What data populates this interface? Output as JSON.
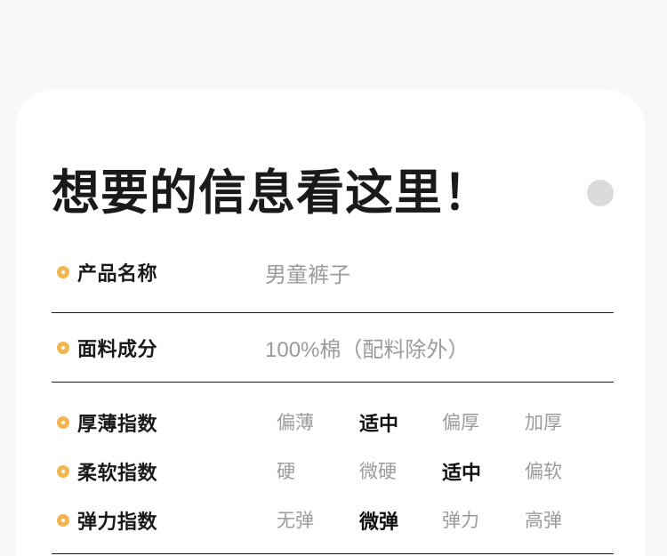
{
  "header": {
    "title": "想要的信息看这里！"
  },
  "colors": {
    "page_bg": "#F8F8F8",
    "card_bg": "#FFFFFF",
    "accent_ring": "#F2B54F",
    "deco_ring": "#DBDBDB",
    "text_dark": "#1A1A1A",
    "text_muted": "#9B9B9B",
    "divider": "#1C1C1C"
  },
  "info_rows": [
    {
      "label": "产品名称",
      "value": "男童裤子"
    },
    {
      "label": "面料成分",
      "value": "100%棉（配料除外）"
    }
  ],
  "index_rows": [
    {
      "label": "厚薄指数",
      "selected": 1,
      "options": [
        "偏薄",
        "适中",
        "偏厚",
        "加厚"
      ]
    },
    {
      "label": "柔软指数",
      "selected": 2,
      "options": [
        "硬",
        "微硬",
        "适中",
        "偏软"
      ]
    },
    {
      "label": "弹力指数",
      "selected": 1,
      "options": [
        "无弹",
        "微弹",
        "弹力",
        "高弹"
      ]
    }
  ]
}
